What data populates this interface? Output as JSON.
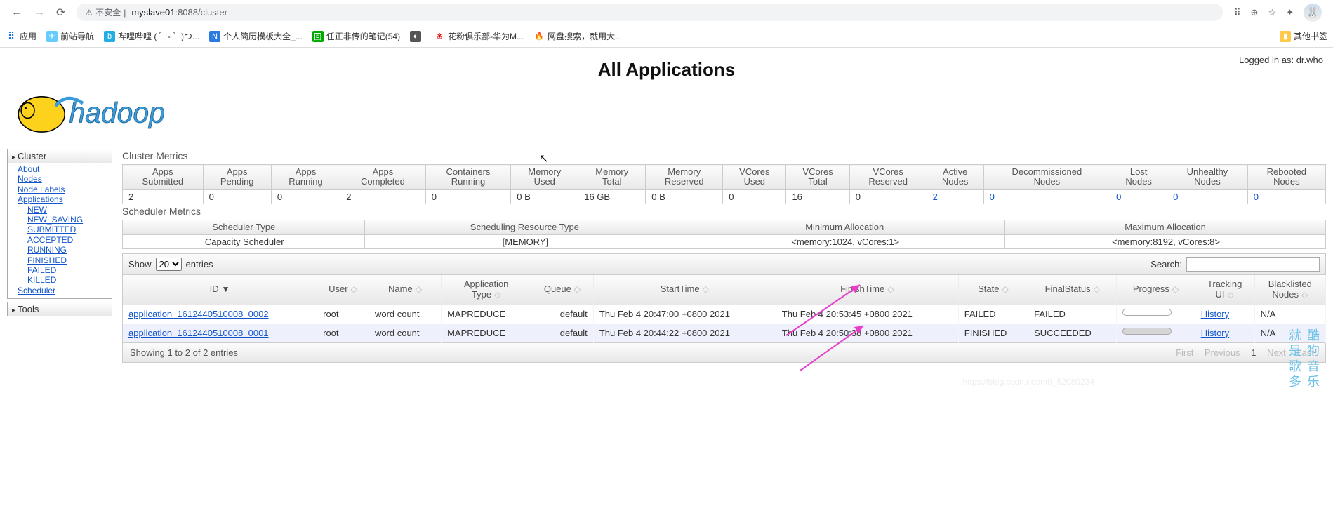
{
  "browser": {
    "insecure_label": "不安全",
    "url_host": "myslave01",
    "url_port": ":8088",
    "url_path": "/cluster"
  },
  "bookmarks": {
    "apps_label": "应用",
    "items": [
      "前站导航",
      "哔哩哔哩 ( ゜- ゜)つ...",
      "个人简历模板大全_...",
      "任正非传的笔记(54)",
      "",
      "花粉俱乐部-华为M...",
      "网盘搜索，就用大..."
    ],
    "other_label": "其他书签"
  },
  "page": {
    "logged_in": "Logged in as: dr.who",
    "title": "All Applications"
  },
  "sidebar": {
    "cluster_head": "Cluster",
    "items": [
      "About",
      "Nodes",
      "Node Labels",
      "Applications"
    ],
    "app_states": [
      "NEW",
      "NEW_SAVING",
      "SUBMITTED",
      "ACCEPTED",
      "RUNNING",
      "FINISHED",
      "FAILED",
      "KILLED"
    ],
    "scheduler": "Scheduler",
    "tools_head": "Tools"
  },
  "cluster_metrics": {
    "title": "Cluster Metrics",
    "headers": [
      "Apps Submitted",
      "Apps Pending",
      "Apps Running",
      "Apps Completed",
      "Containers Running",
      "Memory Used",
      "Memory Total",
      "Memory Reserved",
      "VCores Used",
      "VCores Total",
      "VCores Reserved",
      "Active Nodes",
      "Decommissioned Nodes",
      "Lost Nodes",
      "Unhealthy Nodes",
      "Rebooted Nodes"
    ],
    "values": [
      "2",
      "0",
      "0",
      "2",
      "0",
      "0 B",
      "16 GB",
      "0 B",
      "0",
      "16",
      "0",
      "2",
      "0",
      "0",
      "0",
      "0"
    ],
    "link_cols": [
      11,
      12,
      13,
      14,
      15
    ]
  },
  "scheduler_metrics": {
    "title": "Scheduler Metrics",
    "headers": [
      "Scheduler Type",
      "Scheduling Resource Type",
      "Minimum Allocation",
      "Maximum Allocation"
    ],
    "values": [
      "Capacity Scheduler",
      "[MEMORY]",
      "<memory:1024, vCores:1>",
      "<memory:8192, vCores:8>"
    ]
  },
  "controls": {
    "show": "Show",
    "entries": "entries",
    "page_size": "20",
    "search_label": "Search:"
  },
  "apps_table": {
    "headers": [
      "ID",
      "User",
      "Name",
      "Application Type",
      "Queue",
      "StartTime",
      "FinishTime",
      "State",
      "FinalStatus",
      "Progress",
      "Tracking UI",
      "Blacklisted Nodes"
    ],
    "rows": [
      {
        "id": "application_1612440510008_0002",
        "user": "root",
        "name": "word count",
        "type": "MAPREDUCE",
        "queue": "default",
        "start": "Thu Feb 4 20:47:00 +0800 2021",
        "finish": "Thu Feb 4 20:53:45 +0800 2021",
        "state": "FAILED",
        "final": "FAILED",
        "progress_done": false,
        "tracking": "History",
        "blacklisted": "N/A"
      },
      {
        "id": "application_1612440510008_0001",
        "user": "root",
        "name": "word count",
        "type": "MAPREDUCE",
        "queue": "default",
        "start": "Thu Feb 4 20:44:22 +0800 2021",
        "finish": "Thu Feb 4 20:50:38 +0800 2021",
        "state": "FINISHED",
        "final": "SUCCEEDED",
        "progress_done": true,
        "tracking": "History",
        "blacklisted": "N/A"
      }
    ]
  },
  "footer": {
    "info": "Showing 1 to 2 of 2 entries",
    "first": "First",
    "prev": "Previous",
    "page": "1",
    "next": "Next",
    "last": "Last"
  },
  "watermark": "酷狗音乐 就是歌多",
  "watermark2": "https://blog.csdn.net/m0_52080234"
}
